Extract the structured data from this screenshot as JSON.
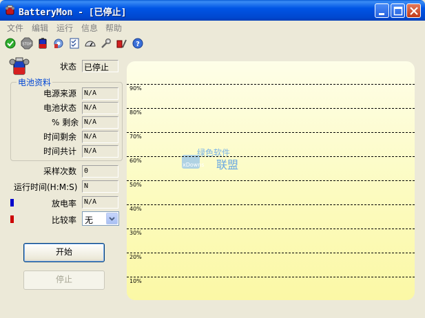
{
  "window": {
    "title": "BatteryMon - [已停止]"
  },
  "menu": [
    "文件",
    "编辑",
    "运行",
    "信息",
    "帮助"
  ],
  "toolbar_icons": [
    "start-icon",
    "stop-icon",
    "battery-icon",
    "gear-icon",
    "checklist-icon",
    "gauge-icon",
    "tools-icon",
    "settings-icon",
    "help-icon"
  ],
  "status": {
    "label": "状态",
    "value": "已停止"
  },
  "battery_info": {
    "title": "电池资料",
    "rows": [
      {
        "label": "电源来源",
        "value": "N/A"
      },
      {
        "label": "电池状态",
        "value": "N/A"
      },
      {
        "label": "% 剩余",
        "value": "N/A"
      },
      {
        "label": "时间剩余",
        "value": "N/A"
      },
      {
        "label": "时间共计",
        "value": "N/A"
      }
    ]
  },
  "samples": {
    "label": "采样次数",
    "value": "0"
  },
  "runtime": {
    "label": "运行时间(H:M:S)",
    "value": "N"
  },
  "discharge": {
    "label": "放电率",
    "value": "N/A",
    "color": "#0000cc"
  },
  "compare": {
    "label": "比较率",
    "value": "无",
    "color": "#cc0000"
  },
  "buttons": {
    "start": "开始",
    "stop": "停止"
  },
  "chart_data": {
    "type": "line",
    "y_ticks": [
      "90%",
      "80%",
      "70%",
      "60%",
      "50%",
      "40%",
      "30%",
      "20%",
      "10%"
    ],
    "series": [],
    "grid": true
  },
  "watermark": {
    "text_top": "绿色软件",
    "text_left": "xDowns",
    "text_right": "联盟"
  }
}
